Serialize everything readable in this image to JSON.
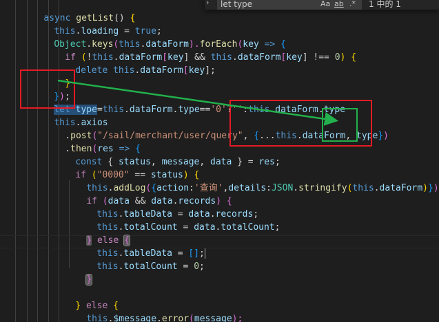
{
  "find_widget": {
    "query": "let type",
    "match_case": "Aa",
    "whole_word": "ab",
    "regex": ".*",
    "result": "1 中的 1"
  },
  "code": {
    "l1": [
      "async",
      " ",
      "getList",
      "() ",
      "{"
    ],
    "l2": [
      "this",
      ".",
      "loading",
      " = ",
      "true",
      ";"
    ],
    "l3": [
      "Object",
      ".",
      "keys",
      "(",
      "this",
      ".",
      "dataForm",
      ").",
      "forEach",
      "(",
      "key",
      " => ",
      "{"
    ],
    "l4": [
      "if",
      " (",
      "!",
      "this",
      ".",
      "dataForm",
      "[",
      "key",
      "] && ",
      "this",
      ".",
      "dataForm",
      "[",
      "key",
      "] !== ",
      "0",
      ") ",
      "{"
    ],
    "l5": [
      "delete",
      " ",
      "this",
      ".",
      "dataForm",
      "[",
      "key",
      "];"
    ],
    "l6": [
      "}"
    ],
    "l7": [
      "}",
      ")",
      ";"
    ],
    "l8": [
      "let",
      " ",
      "type",
      "=",
      "this",
      ".",
      "dataForm",
      ".",
      "type",
      "==",
      "'0'",
      "?",
      "''",
      ":",
      "this",
      ".",
      "dataForm",
      ".",
      "type"
    ],
    "l9": [
      "this",
      ".",
      "axios"
    ],
    "l10": [
      ".",
      "post",
      "(",
      "\"/sail/merchant/user/query\"",
      ", ",
      "{",
      "...",
      "this",
      ".",
      "dataForm",
      ", ",
      "type",
      "}",
      ")"
    ],
    "l11": [
      ".",
      "then",
      "(",
      "res",
      " => ",
      "{"
    ],
    "l12": [
      "const",
      " { ",
      "status",
      ", ",
      "message",
      ", ",
      "data",
      " } = ",
      "res",
      ";"
    ],
    "l13": [
      "if",
      " (",
      "\"0000\"",
      " == ",
      "status",
      ") ",
      "{"
    ],
    "l14": [
      "this",
      ".",
      "addLog",
      "(",
      "{",
      "action",
      ":",
      "'查询'",
      ",",
      "details",
      ":",
      "JSON",
      ".",
      "stringify",
      "(",
      "this",
      ".",
      "dataForm",
      ")",
      "}",
      ")"
    ],
    "l15": [
      "if",
      " (",
      "data",
      " && ",
      "data",
      ".",
      "records",
      ") ",
      "{"
    ],
    "l16": [
      "this",
      ".",
      "tableData",
      " = ",
      "data",
      ".",
      "records",
      ";"
    ],
    "l17": [
      "this",
      ".",
      "totalCount",
      " = ",
      "data",
      ".",
      "totalCount",
      ";"
    ],
    "l18": [
      "}",
      " ",
      "else",
      " ",
      "{"
    ],
    "l19": [
      "this",
      ".",
      "tableData",
      " = ",
      "[]",
      ";"
    ],
    "l20": [
      "this",
      ".",
      "totalCount",
      " = ",
      "0",
      ";"
    ],
    "l21": [
      "}"
    ],
    "l23": [
      "}",
      " ",
      "else",
      " ",
      "{"
    ],
    "l24": [
      "this",
      ".",
      "$message",
      ".",
      "error",
      "(",
      "message",
      ");"
    ],
    "l25": [
      "}"
    ]
  },
  "colors": {
    "background": "#1e1e1e",
    "annotation_red": "#e31b23",
    "annotation_green": "#22b14c"
  }
}
